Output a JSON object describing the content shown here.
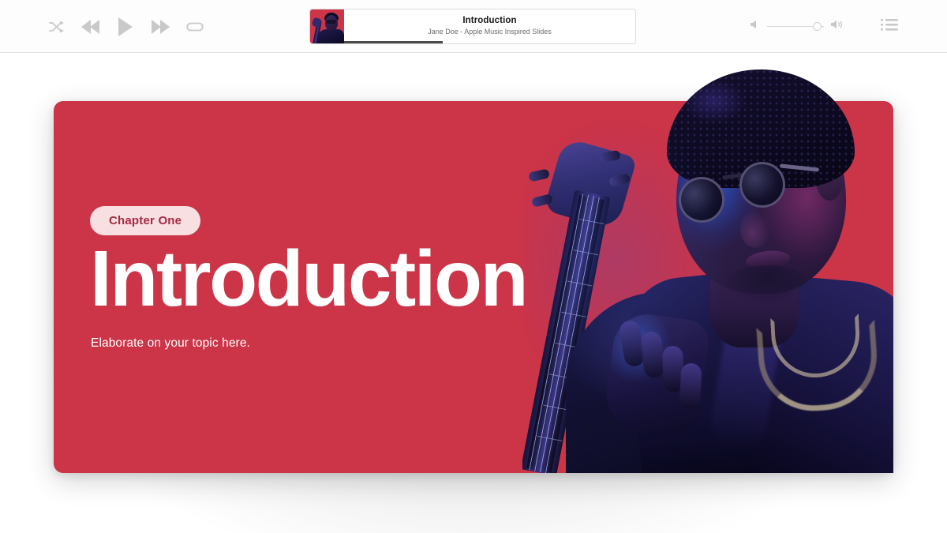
{
  "player": {
    "transport": {
      "shuffle_label": "Shuffle",
      "previous_label": "Previous",
      "play_label": "Play",
      "next_label": "Next",
      "repeat_label": "Repeat"
    },
    "now_playing": {
      "title": "Introduction",
      "subtitle": "Jane Doe - Apple Music Inspired Slides",
      "artwork_label": "Album artwork",
      "progress_percent": 34
    },
    "volume": {
      "label": "Volume",
      "level_percent": 88,
      "mute_label": "Volume down",
      "max_label": "Volume up"
    },
    "queue_label": "Playing Next"
  },
  "slide": {
    "chapter_badge": "Chapter One",
    "title": "Introduction",
    "subtitle": "Elaborate on your topic here.",
    "photo_label": "Musician playing bass guitar",
    "colors": {
      "background": "#CC3448",
      "badge_background": "#F8DFE2",
      "badge_text": "#A32B42",
      "title_text": "#FFFFFF"
    }
  }
}
